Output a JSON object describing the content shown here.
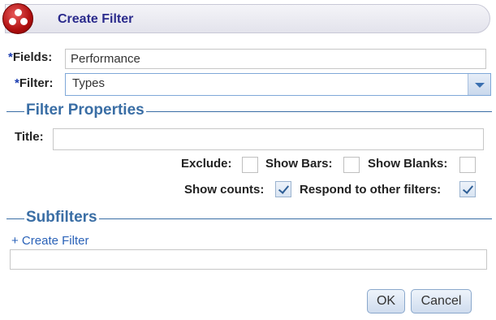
{
  "dialog": {
    "title": "Create Filter"
  },
  "form": {
    "required_marker": "*",
    "fields_label": "Fields:",
    "fields_value": "Performance",
    "filter_label": "Filter:",
    "filter_value": "Types"
  },
  "filter_properties": {
    "heading": "Filter Properties",
    "title_label": "Title:",
    "title_value": "",
    "exclude_label": "Exclude:",
    "exclude_checked": false,
    "show_bars_label": "Show Bars:",
    "show_bars_checked": false,
    "show_blanks_label": "Show Blanks:",
    "show_blanks_checked": false,
    "show_counts_label": "Show counts:",
    "show_counts_checked": true,
    "respond_label": "Respond to other filters:",
    "respond_checked": true
  },
  "subfilters": {
    "heading": "Subfilters",
    "create_link": "+ Create Filter"
  },
  "buttons": {
    "ok": "OK",
    "cancel": "Cancel"
  },
  "icons": {
    "logo": "app-logo-icon",
    "dropdown": "chevron-down-icon"
  },
  "colors": {
    "accent": "#3a6ea5",
    "title_text": "#2b2b8c",
    "required": "#1a3cb0"
  }
}
